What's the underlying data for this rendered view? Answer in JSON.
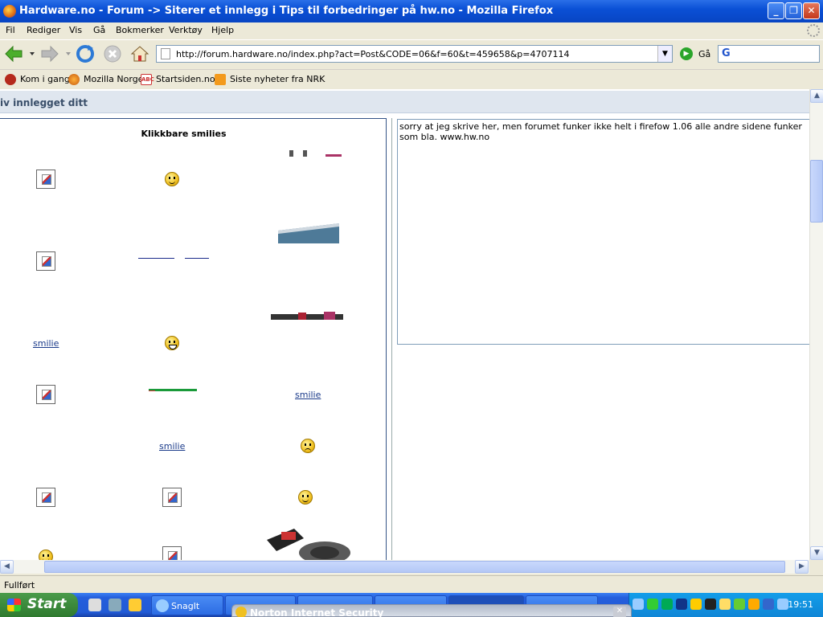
{
  "window": {
    "title": "Hardware.no - Forum -> Siterer et innlegg i Tips til forbedringer på hw.no - Mozilla Firefox",
    "minimize": "_",
    "maximize": "❐",
    "close": "✕"
  },
  "menu": [
    "Fil",
    "Rediger",
    "Vis",
    "Gå",
    "Bokmerker",
    "Verktøy",
    "Hjelp"
  ],
  "nav": {
    "url": "http://forum.hardware.no/index.php?act=Post&CODE=06&f=60&t=459658&p=4707114",
    "go_label": "Gå",
    "search_logo": "G"
  },
  "bookmarks": [
    {
      "label": "Kom i gang",
      "icon": "red-bookmark-icon"
    },
    {
      "label": "Mozilla Norge",
      "icon": "firefox-icon"
    },
    {
      "label": "Startsiden.no",
      "icon": "abc-icon"
    },
    {
      "label": "Siste nyheter fra NRK",
      "icon": "rss-feed-icon"
    }
  ],
  "page": {
    "header": "iv innlegget ditt",
    "smilies_title": "Klikkbare smilies",
    "smilie_link": "smilie",
    "message": "sorry at jeg skrive her, men forumet funker ikke helt i firefow 1.06 alle andre sidene funker som bla. www.hw.no"
  },
  "status": {
    "text": "Fullført"
  },
  "taskbar": {
    "start": "Start",
    "snagit": "SnagIt",
    "clock": "19:51",
    "norton": "Norton Internet Security"
  },
  "colors": {
    "titlebar": "#0a50d6",
    "header_bar": "#dfe6ef",
    "panel_border": "#345487",
    "link": "#1a3a8a",
    "start_green": "#3c8a3c"
  }
}
